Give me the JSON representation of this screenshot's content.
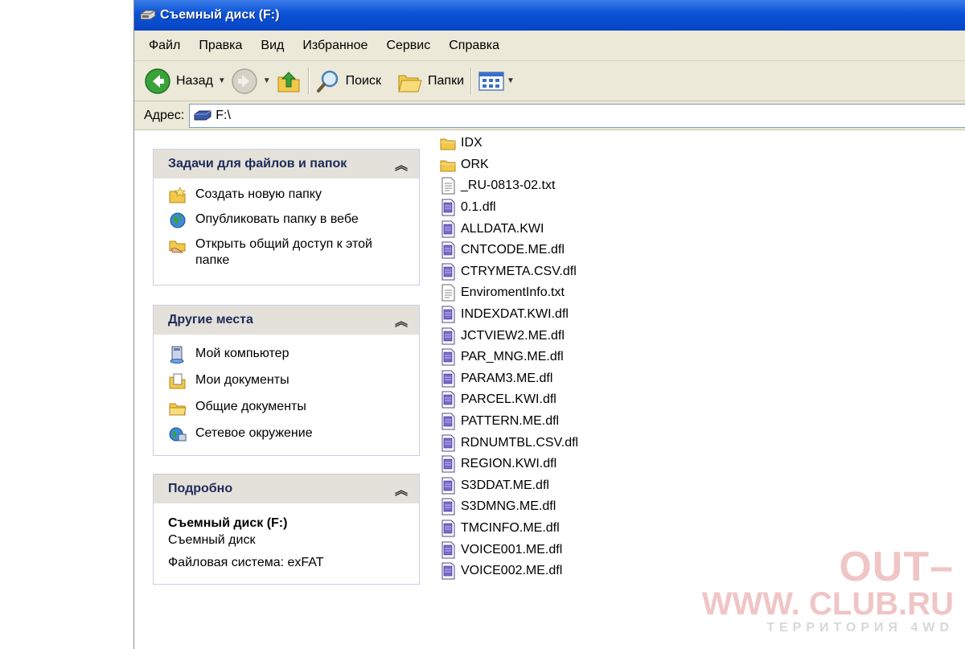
{
  "window": {
    "title": "Съемный диск (F:)"
  },
  "menu": [
    "Файл",
    "Правка",
    "Вид",
    "Избранное",
    "Сервис",
    "Справка"
  ],
  "toolbar": {
    "back_label": "Назад",
    "search_label": "Поиск",
    "folders_label": "Папки"
  },
  "address": {
    "label": "Адрес:",
    "value": "F:\\"
  },
  "tasks_panel": {
    "title": "Задачи для файлов и папок",
    "items": [
      "Создать новую папку",
      "Опубликовать папку в вебе",
      "Открыть общий доступ к этой папке"
    ]
  },
  "places_panel": {
    "title": "Другие места",
    "items": [
      "Мой компьютер",
      "Мои документы",
      "Общие документы",
      "Сетевое окружение"
    ]
  },
  "details_panel": {
    "title": "Подробно",
    "name": "Съемный диск (F:)",
    "type": "Съемный диск",
    "filesystem": "Файловая система: exFAT"
  },
  "files": [
    {
      "name": "IDX",
      "kind": "folder"
    },
    {
      "name": "ORK",
      "kind": "folder"
    },
    {
      "name": "_RU-0813-02.txt",
      "kind": "text"
    },
    {
      "name": "0.1.dfl",
      "kind": "dfl"
    },
    {
      "name": "ALLDATA.KWI",
      "kind": "dfl"
    },
    {
      "name": "CNTCODE.ME.dfl",
      "kind": "dfl"
    },
    {
      "name": "CTRYMETA.CSV.dfl",
      "kind": "dfl"
    },
    {
      "name": "EnviromentInfo.txt",
      "kind": "text"
    },
    {
      "name": "INDEXDAT.KWI.dfl",
      "kind": "dfl"
    },
    {
      "name": "JCTVIEW2.ME.dfl",
      "kind": "dfl"
    },
    {
      "name": "PAR_MNG.ME.dfl",
      "kind": "dfl"
    },
    {
      "name": "PARAM3.ME.dfl",
      "kind": "dfl"
    },
    {
      "name": "PARCEL.KWI.dfl",
      "kind": "dfl"
    },
    {
      "name": "PATTERN.ME.dfl",
      "kind": "dfl"
    },
    {
      "name": "RDNUMTBL.CSV.dfl",
      "kind": "dfl"
    },
    {
      "name": "REGION.KWI.dfl",
      "kind": "dfl"
    },
    {
      "name": "S3DDAT.ME.dfl",
      "kind": "dfl"
    },
    {
      "name": "S3DMNG.ME.dfl",
      "kind": "dfl"
    },
    {
      "name": "TMCINFO.ME.dfl",
      "kind": "dfl"
    },
    {
      "name": "VOICE001.ME.dfl",
      "kind": "dfl"
    },
    {
      "name": "VOICE002.ME.dfl",
      "kind": "dfl"
    }
  ],
  "watermark": {
    "line1": "OUT–",
    "line2": "WWW. CLUB.RU",
    "line3": "ТЕРРИТОРИЯ 4WD"
  },
  "colors": {
    "titlebar": "#0a52d6",
    "chrome": "#ece9d8",
    "panel_head": "#e4e1da"
  }
}
